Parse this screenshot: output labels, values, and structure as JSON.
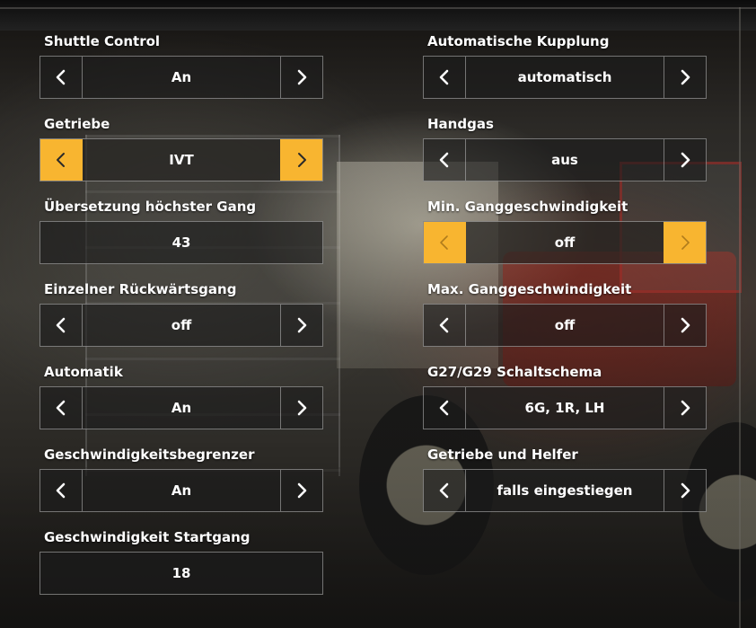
{
  "settings": [
    {
      "label": "Shuttle Control",
      "value": "An",
      "arrows": true
    },
    {
      "label": "Automatische Kupplung",
      "value": "automatisch",
      "arrows": true
    },
    {
      "label": "Getriebe",
      "value": "IVT",
      "arrows": true,
      "highlighted": true
    },
    {
      "label": "Handgas",
      "value": "aus",
      "arrows": true
    },
    {
      "label": "Übersetzung höchster Gang",
      "value": "43",
      "arrows": false
    },
    {
      "label": "Min. Ganggeschwindigkeit",
      "value": "off",
      "arrows": true,
      "highlighted": true,
      "arrows_disabled": true
    },
    {
      "label": "Einzelner Rückwärtsgang",
      "value": "off",
      "arrows": true
    },
    {
      "label": "Max. Ganggeschwindigkeit",
      "value": "off",
      "arrows": true
    },
    {
      "label": "Automatik",
      "value": "An",
      "arrows": true
    },
    {
      "label": "G27/G29 Schaltschema",
      "value": "6G, 1R, LH",
      "arrows": true
    },
    {
      "label": "Geschwindigkeitsbegrenzer",
      "value": "An",
      "arrows": true
    },
    {
      "label": "Getriebe und Helfer",
      "value": "falls eingestiegen",
      "arrows": true
    },
    {
      "label": "Geschwindigkeit Startgang",
      "value": "18",
      "arrows": false
    }
  ],
  "icons": {
    "previous": "chevron-left-icon",
    "next": "chevron-right-icon"
  },
  "colors": {
    "highlight": "#f8b530",
    "text": "#ffffff",
    "box_background": "#1c1c1c"
  }
}
